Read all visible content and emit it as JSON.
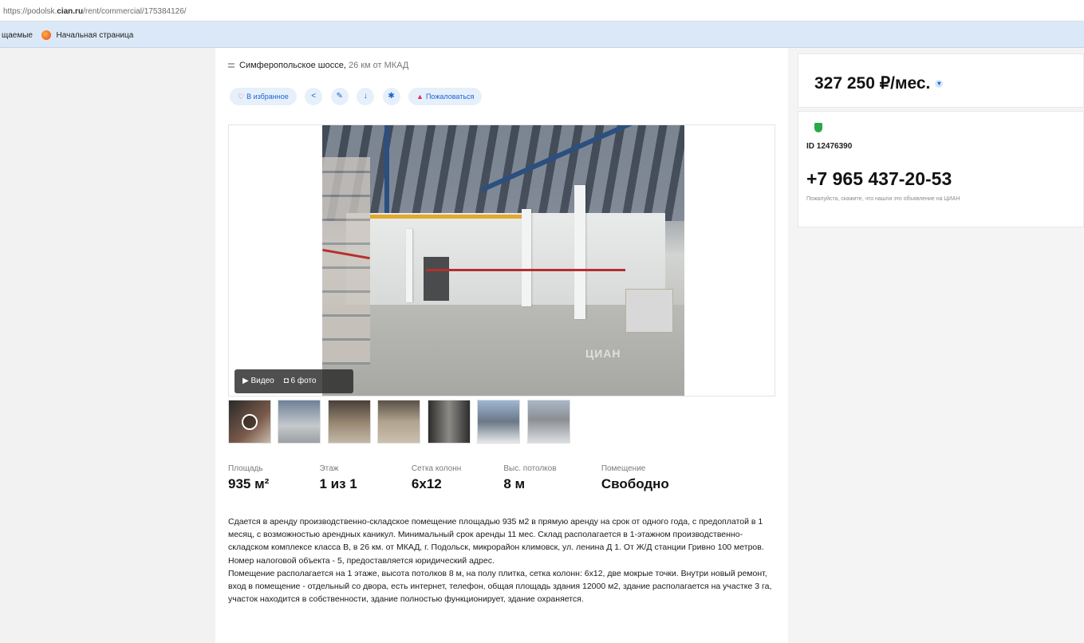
{
  "browser": {
    "url_prefix": "https://podolsk.",
    "url_domain": "cian.ru",
    "url_path": "/rent/commercial/175384126/",
    "bookmark_1": "щаемые",
    "bookmark_2": "Начальная страница"
  },
  "listing": {
    "highway": "Симферопольское шоссе,",
    "distance": "26 км от МКАД",
    "actions": {
      "favorite": "В избранное",
      "report": "Пожаловаться"
    },
    "gallery": {
      "video_label": "Видео",
      "photos_label": "6 фото",
      "watermark": "ЦИАН"
    },
    "specs": [
      {
        "label": "Площадь",
        "value": "935 м²"
      },
      {
        "label": "Этаж",
        "value": "1 из 1"
      },
      {
        "label": "Сетка колонн",
        "value": "6х12"
      },
      {
        "label": "Выс. потолков",
        "value": "8 м"
      },
      {
        "label": "Помещение",
        "value": "Свободно"
      }
    ],
    "description_1": "Сдается в аренду производственно-складское помещение площадью 935 м2 в прямую аренду на срок от одного года, с предоплатой в 1 месяц, с возможностью арендных каникул. Минимальный срок аренды 11 мес. Склад располагается в 1-этажном производственно-складском комплексе класса В, в 26 км. от МКАД, г. Подольск, микрорайон климовск, ул. ленина Д 1. От Ж/Д станции Гривно 100 метров. Номер налоговой объекта - 5, предоставляется юридический адрес.",
    "description_2": "Помещение располагается на 1 этаже, высота потолков 8 м, на полу плитка, сетка колонн: 6х12, две мокрые точки. Внутри новый ремонт, вход в помещение - отдельный со двора, есть интернет, телефон, общая площадь здания 12000 м2, здание располагается на участке 3 га, участок находится в собственности, здание полностью функционирует, здание охраняется."
  },
  "sidebar": {
    "price": "327 250 ₽/мес.",
    "listing_id": "ID 12476390",
    "phone": "+7 965 437-20-53",
    "hint": "Пожалуйста, скажите, что нашли это объявление на ЦИАН"
  }
}
